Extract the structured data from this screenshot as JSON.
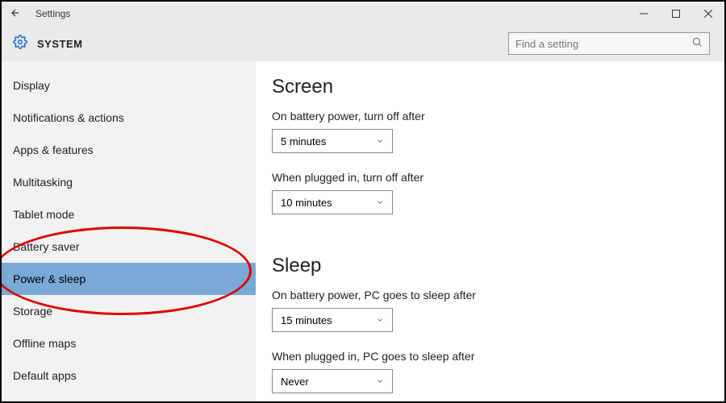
{
  "titlebar": {
    "title": "Settings"
  },
  "header": {
    "section": "SYSTEM",
    "search_placeholder": "Find a setting"
  },
  "sidebar": {
    "items": [
      {
        "label": "Display",
        "selected": false
      },
      {
        "label": "Notifications & actions",
        "selected": false
      },
      {
        "label": "Apps & features",
        "selected": false
      },
      {
        "label": "Multitasking",
        "selected": false
      },
      {
        "label": "Tablet mode",
        "selected": false
      },
      {
        "label": "Battery saver",
        "selected": false
      },
      {
        "label": "Power & sleep",
        "selected": true
      },
      {
        "label": "Storage",
        "selected": false
      },
      {
        "label": "Offline maps",
        "selected": false
      },
      {
        "label": "Default apps",
        "selected": false
      }
    ]
  },
  "content": {
    "screen": {
      "heading": "Screen",
      "battery_label": "On battery power, turn off after",
      "battery_value": "5 minutes",
      "plugged_label": "When plugged in, turn off after",
      "plugged_value": "10 minutes"
    },
    "sleep": {
      "heading": "Sleep",
      "battery_label": "On battery power, PC goes to sleep after",
      "battery_value": "15 minutes",
      "plugged_label": "When plugged in, PC goes to sleep after",
      "plugged_value": "Never"
    }
  },
  "annotation": {
    "highlighted_item": "Power & sleep"
  }
}
